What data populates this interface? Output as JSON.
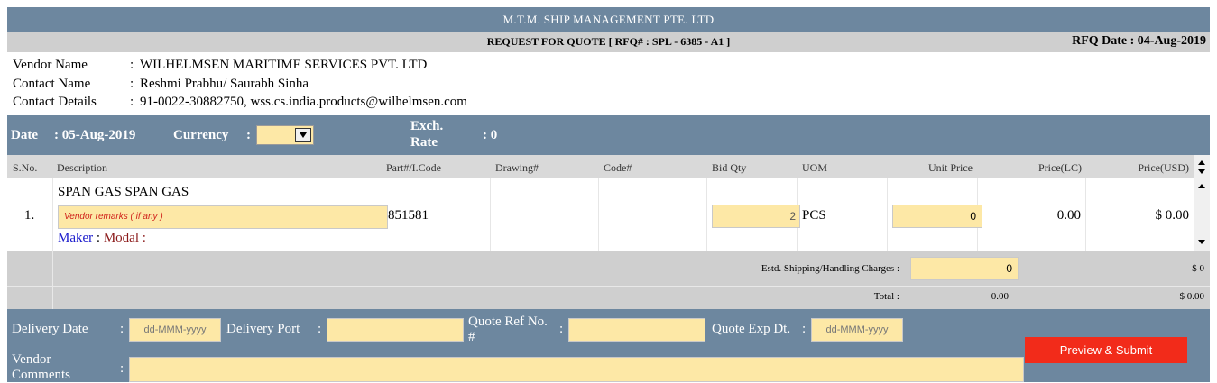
{
  "header": {
    "company": "M.T.M. SHIP MANAGEMENT PTE. LTD",
    "rfq_title": "REQUEST FOR QUOTE [ RFQ# : SPL - 6385 - A1 ]",
    "rfq_date": "RFQ Date : 04-Aug-2019"
  },
  "vendor": {
    "name_label": "Vendor Name",
    "name": "WILHELMSEN MARITIME SERVICES PVT. LTD",
    "contact_label": "Contact Name",
    "contact": "Reshmi Prabhu/ Saurabh Sinha",
    "details_label": "Contact Details",
    "details": "91-0022-30882750, wss.cs.india.products@wilhelmsen.com",
    "colon": ":"
  },
  "band": {
    "date_label": "Date",
    "date_value": ": 05-Aug-2019",
    "currency_label": "Currency",
    "currency_colon": ":",
    "exch_label_1": "Exch.",
    "exch_label_2": "Rate",
    "exch_value": ": 0"
  },
  "table": {
    "headers": [
      "S.No.",
      "Description",
      "Part#/I.Code",
      "Drawing#",
      "Code#",
      "Bid Qty",
      "UOM",
      "Unit Price",
      "Price(LC)",
      "Price(USD)"
    ],
    "row": {
      "sno": "1.",
      "description": "SPAN GAS SPAN GAS",
      "remarks_placeholder": "Vendor remarks ( if any )",
      "maker_label": "Maker",
      "maker_sep": ":",
      "modal_label": "Modal :",
      "part_code": "851581",
      "bid_qty": "2",
      "uom": "PCS",
      "unit_price": "0",
      "price_lc": "0.00",
      "price_usd": "$ 0.00"
    }
  },
  "summary": {
    "shipping_label": "Estd. Shipping/Handling Charges :",
    "shipping_value": "0",
    "shipping_usd": "$ 0",
    "total_label": "Total :",
    "total_lc": "0.00",
    "total_usd": "$ 0.00"
  },
  "footer": {
    "delivery_date_label": "Delivery Date",
    "date_placeholder": "dd-MMM-yyyy",
    "delivery_port_label": "Delivery Port",
    "quote_ref_label_1": "Quote Ref No.",
    "quote_ref_label_2": "#",
    "quote_exp_label": "Quote Exp Dt.",
    "vendor_comments_label_1": "Vendor",
    "vendor_comments_label_2": "Comments",
    "colon": ":",
    "submit_label": "Preview & Submit"
  },
  "colors": {
    "band": "#6d879f",
    "input": "#fde8a6",
    "submit": "#f22b1a",
    "maker": "#1a1acc",
    "modal": "#8b1a1a"
  }
}
